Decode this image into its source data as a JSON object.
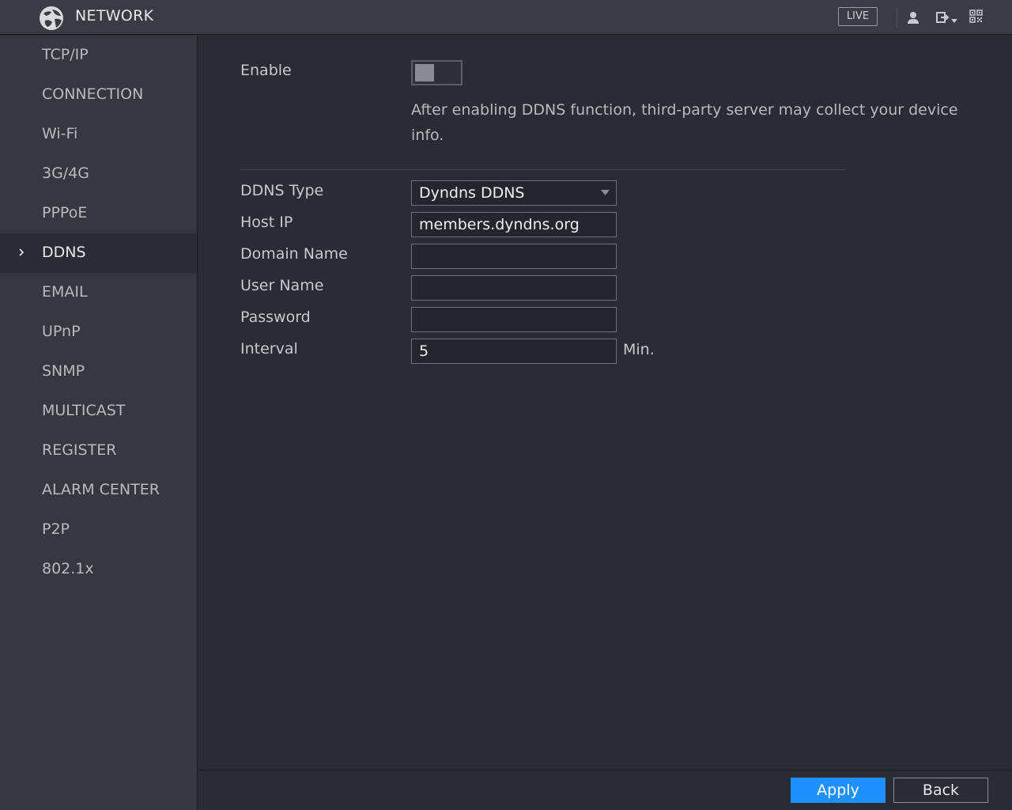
{
  "header": {
    "title": "NETWORK",
    "live_label": "LIVE",
    "icons": [
      "globe-logo-icon",
      "user-icon",
      "logout-icon",
      "qr-code-icon"
    ]
  },
  "sidebar": {
    "items": [
      {
        "label": "TCP/IP"
      },
      {
        "label": "CONNECTION"
      },
      {
        "label": "Wi-Fi"
      },
      {
        "label": "3G/4G"
      },
      {
        "label": "PPPoE"
      },
      {
        "label": "DDNS",
        "active": true
      },
      {
        "label": "EMAIL"
      },
      {
        "label": "UPnP"
      },
      {
        "label": "SNMP"
      },
      {
        "label": "MULTICAST"
      },
      {
        "label": "REGISTER"
      },
      {
        "label": "ALARM CENTER"
      },
      {
        "label": "P2P"
      },
      {
        "label": "802.1x"
      }
    ]
  },
  "form": {
    "enable_label": "Enable",
    "enable_value": false,
    "notice": "After enabling DDNS function, third-party server may collect your device info.",
    "ddns_type_label": "DDNS Type",
    "ddns_type_value": "Dyndns DDNS",
    "host_ip_label": "Host IP",
    "host_ip_value": "members.dyndns.org",
    "domain_name_label": "Domain Name",
    "domain_name_value": "",
    "user_name_label": "User Name",
    "user_name_value": "",
    "password_label": "Password",
    "password_value": "",
    "interval_label": "Interval",
    "interval_value": "5",
    "interval_unit": "Min."
  },
  "footer": {
    "apply_label": "Apply",
    "back_label": "Back"
  },
  "colors": {
    "accent": "#1e90ff",
    "background": "#2a2b33",
    "sidebar": "#36373f",
    "header": "#3a3b43"
  }
}
